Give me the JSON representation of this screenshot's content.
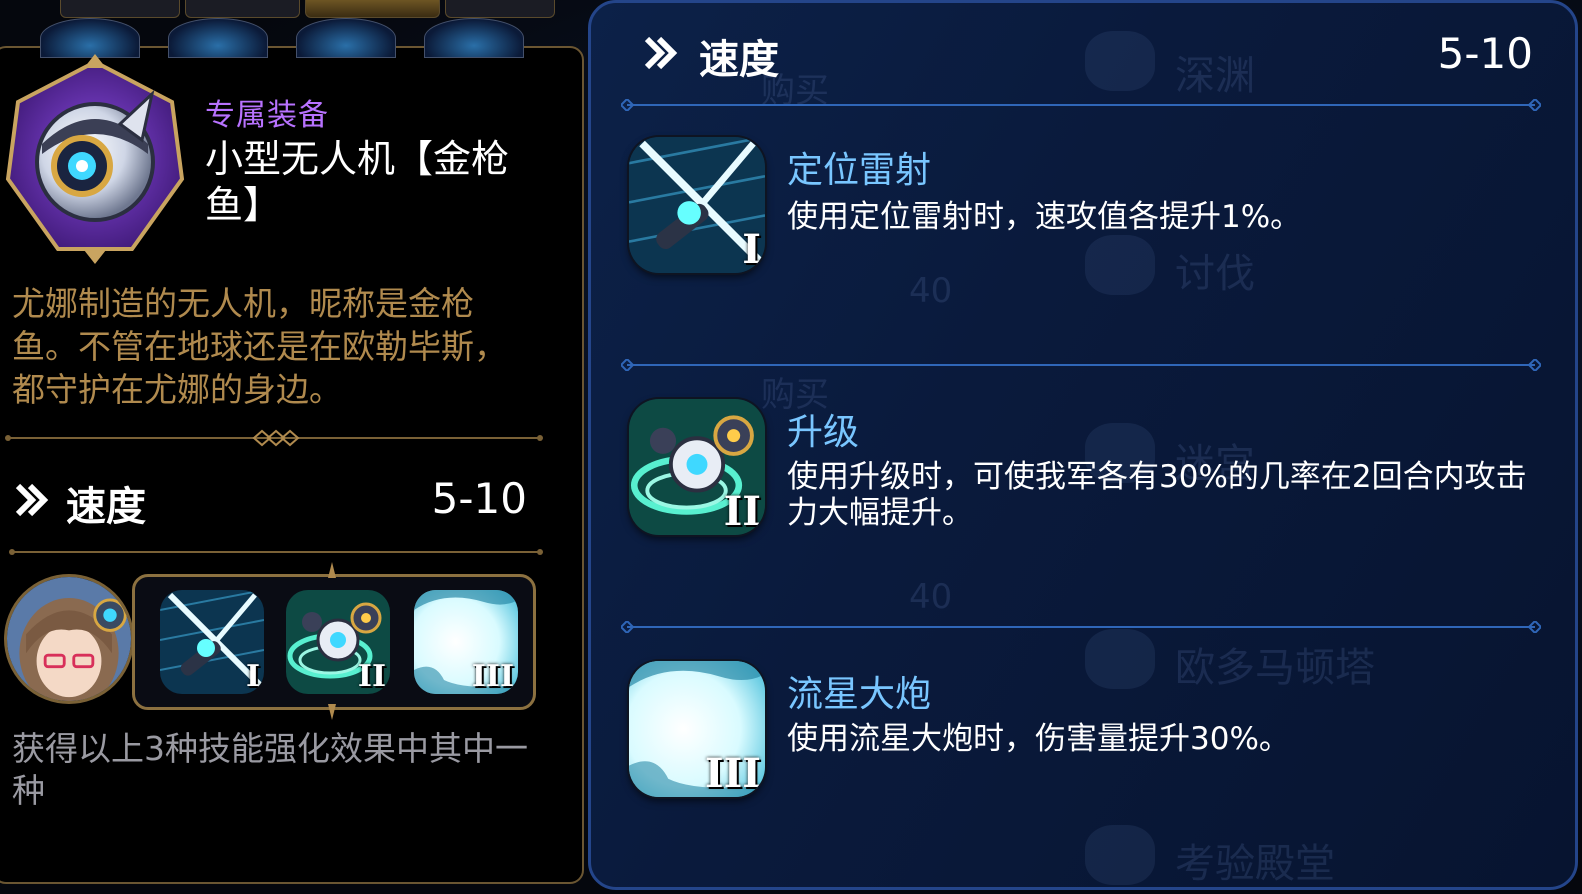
{
  "equipment": {
    "category_label": "专属装备",
    "name": "小型无人机【金枪鱼】",
    "description": "尤娜制造的无人机，昵称是金枪鱼。不管在地球还是在欧勒毕斯，都守护在尤娜的身边。"
  },
  "left_stat": {
    "label": "速度",
    "value": "5-10"
  },
  "skills": [
    {
      "roman": "I",
      "icon": "laser-skill-icon"
    },
    {
      "roman": "II",
      "icon": "drone-upgrade-skill-icon"
    },
    {
      "roman": "III",
      "icon": "meteor-cannon-skill-icon"
    }
  ],
  "grant_text": "获得以上3种技能强化效果中其中一种",
  "right_stat": {
    "label": "速度",
    "value": "5-10"
  },
  "skill_effects": [
    {
      "title": "定位雷射",
      "description": "使用定位雷射时，速攻值各提升1%。",
      "roman": "I"
    },
    {
      "title": "升级",
      "description": "使用升级时，可使我军各有30%的几率在2回合内攻击力大幅提升。",
      "roman": "II"
    },
    {
      "title": "流星大炮",
      "description": "使用流星大炮时，伤害量提升30%。",
      "roman": "III"
    }
  ],
  "background_menu": [
    "深渊",
    "购买",
    "讨伐",
    "40",
    "购买",
    "迷宫",
    "40",
    "欧多马顿塔",
    "考验殿堂"
  ],
  "colors": {
    "category_purple": "#b872ff",
    "description_gold": "#b08a4e",
    "skill_title_blue": "#79c6ff",
    "panel_navy": "#0a1a3c",
    "frame_gold": "#8c7140"
  }
}
